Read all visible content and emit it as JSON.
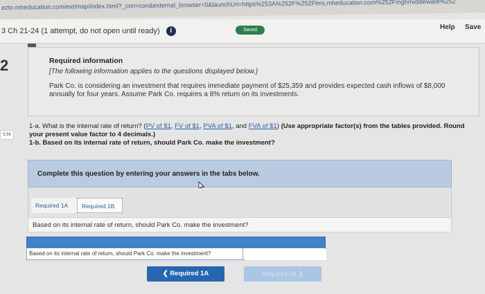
{
  "browser": {
    "url": "ezto.mheducation.com/ext/map/index.html?_con=con&external_browser=0&launchUrl=https%253A%252F%252Flms.mheducation.com%252Fmghmiddleware%252"
  },
  "header": {
    "title": "3 Ch 21-24 (1 attempt, do not open until ready)",
    "info_icon": "i",
    "status_badge": "Saved",
    "help_label": "Help",
    "save_label": "Save"
  },
  "sidebar": {
    "question_number": "2",
    "points_badge": "5.56"
  },
  "info": {
    "title": "Required information",
    "note": "[The following information applies to the questions displayed below.]",
    "body": "Park Co. is considering an investment that requires immediate payment of $25,359 and provides expected cash inflows of $8,000 annually for four years. Assume Park Co. requires a 8% return on its investments."
  },
  "question": {
    "q1a_prefix": "1-a. What is the internal rate of return? (",
    "link_pv": "PV of $1",
    "link_fv": "FV of $1",
    "link_pva": "PVA of $1",
    "link_and": ", and ",
    "link_fva": "FVA of $1",
    "close_paren": ")",
    "instruction": "(Use appropriate factor(s) from the tables provided. Round your present value factor to 4 decimals.)",
    "q1b": "1-b. Based on its internal rate of return, should Park Co. make the investment?"
  },
  "panel": {
    "complete_text": "Complete this question by entering your answers in the tabs below."
  },
  "tabs": [
    {
      "label": "Required 1A"
    },
    {
      "label": "Required 1B"
    }
  ],
  "tab_content": {
    "question": "Based on its internal rate of return, should Park Co. make the investment?",
    "answer_label": "Based on its internal rate of return, should Park Co. make the investment?",
    "answer_value": ""
  },
  "nav": {
    "prev_label": "❮  Required 1A",
    "next_label": "Required 1B  ❯"
  }
}
